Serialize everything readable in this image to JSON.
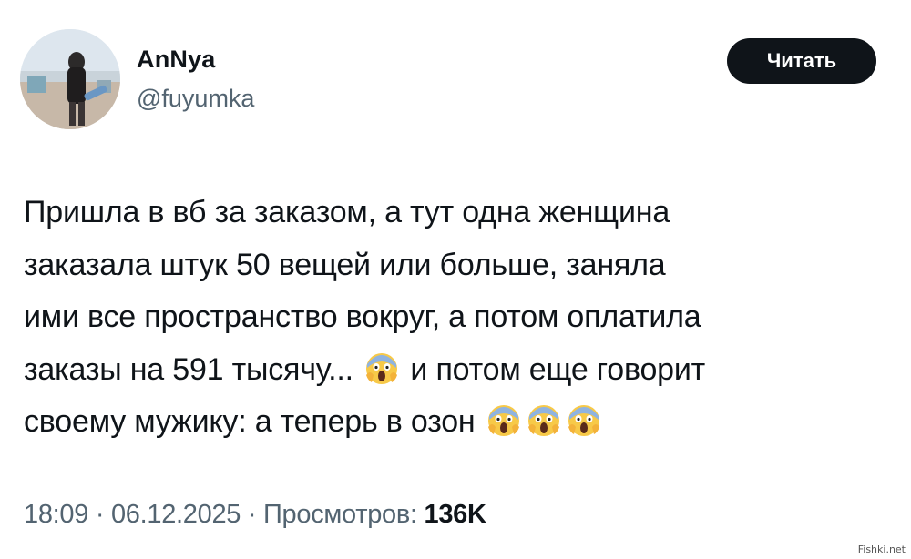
{
  "author": {
    "display_name": "AnNya",
    "handle": "@fuyumka"
  },
  "header": {
    "read_button_label": "Читать"
  },
  "tweet": {
    "lines": [
      "Пришла в вб за заказом, а тут одна женщина",
      "заказала штук 50 вещей или больше, заняла",
      "ими все пространство вокруг, а потом оплатила",
      "заказы на 591 тысячу...",
      "и потом еще говорит",
      "своему мужику: а теперь в озон"
    ],
    "emoji_icon": "face-screaming-in-fear-icon"
  },
  "meta": {
    "time": "18:09",
    "separator": "·",
    "date": "06.12.2025",
    "views_label": "Просмотров:",
    "views_count": "136K"
  },
  "watermark": "Fishki.net",
  "colors": {
    "text": "#0f1419",
    "secondary_text": "#536471",
    "button_bg": "#0f1419",
    "button_text": "#ffffff"
  }
}
